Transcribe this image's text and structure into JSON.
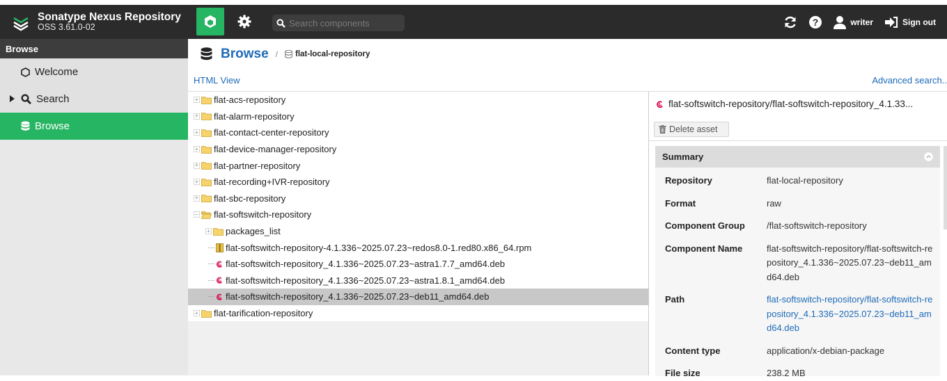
{
  "app": {
    "title": "Sonatype Nexus Repository",
    "version": "OSS 3.61.0-02"
  },
  "topbar": {
    "search_placeholder": "Search components",
    "user": "writer",
    "signout": "Sign out"
  },
  "sidebar": {
    "header": "Browse",
    "items": [
      {
        "label": "Welcome",
        "icon": "hexagon-icon"
      },
      {
        "label": "Search",
        "icon": "search-icon"
      },
      {
        "label": "Browse",
        "icon": "database-icon",
        "active": true
      }
    ]
  },
  "breadcrumb": {
    "main": "Browse",
    "separator": "/",
    "sub": "flat-local-repository"
  },
  "links": {
    "html_view": "HTML View",
    "advanced_search": "Advanced search.."
  },
  "tree": {
    "rows": [
      {
        "label": "flat-acs-repository",
        "type": "folder",
        "depth": 0
      },
      {
        "label": "flat-alarm-repository",
        "type": "folder",
        "depth": 0
      },
      {
        "label": "flat-contact-center-repository",
        "type": "folder",
        "depth": 0
      },
      {
        "label": "flat-device-manager-repository",
        "type": "folder",
        "depth": 0
      },
      {
        "label": "flat-partner-repository",
        "type": "folder",
        "depth": 0
      },
      {
        "label": "flat-recording+IVR-repository",
        "type": "folder",
        "depth": 0
      },
      {
        "label": "flat-sbc-repository",
        "type": "folder",
        "depth": 0
      },
      {
        "label": "flat-softswitch-repository",
        "type": "folder-open",
        "depth": 0
      },
      {
        "label": "packages_list",
        "type": "folder",
        "depth": 1
      },
      {
        "label": "flat-softswitch-repository-4.1.336~2025.07.23~redos8.0-1.red80.x86_64.rpm",
        "type": "rpm",
        "depth": 1
      },
      {
        "label": "flat-softswitch-repository_4.1.336~2025.07.23~astra1.7.7_amd64.deb",
        "type": "deb",
        "depth": 1
      },
      {
        "label": "flat-softswitch-repository_4.1.336~2025.07.23~astra1.8.1_amd64.deb",
        "type": "deb",
        "depth": 1
      },
      {
        "label": "flat-softswitch-repository_4.1.336~2025.07.23~deb11_amd64.deb",
        "type": "deb",
        "depth": 1,
        "selected": true
      },
      {
        "label": "flat-tarification-repository",
        "type": "folder",
        "depth": 0
      }
    ]
  },
  "detail": {
    "title": "flat-softswitch-repository/flat-softswitch-repository_4.1.33...",
    "delete_label": "Delete asset",
    "summary_label": "Summary",
    "fields": [
      {
        "key": "Repository",
        "value": "flat-local-repository"
      },
      {
        "key": "Format",
        "value": "raw"
      },
      {
        "key": "Component Group",
        "value": "/flat-softswitch-repository"
      },
      {
        "key": "Component Name",
        "value": "flat-softswitch-repository/flat-softswitch-repository_4.1.336~2025.07.23~deb11_amd64.deb"
      },
      {
        "key": "Path",
        "value": "flat-softswitch-repository/flat-softswitch-repository_4.1.336~2025.07.23~deb11_amd64.deb",
        "link": true
      },
      {
        "key": "Content type",
        "value": "application/x-debian-package"
      },
      {
        "key": "File size",
        "value": "238.2 MB"
      }
    ]
  },
  "colors": {
    "accent": "#26b562",
    "link": "#1e6bb8",
    "topbar": "#2b2b2b",
    "debian": "#d70a53"
  }
}
